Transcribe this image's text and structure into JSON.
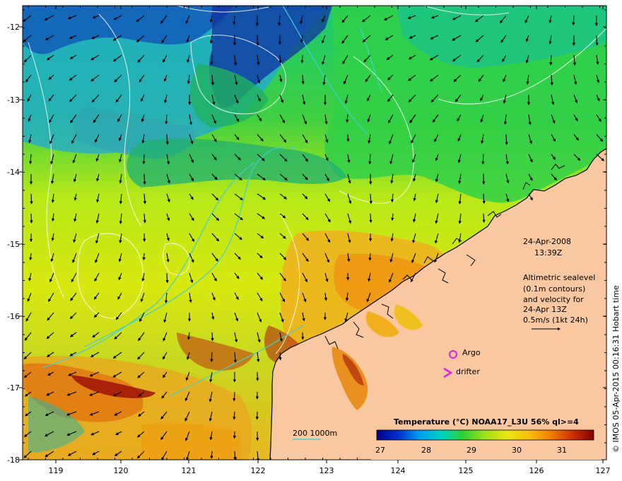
{
  "map": {
    "lon_ticks": [
      "119",
      "120",
      "121",
      "122",
      "123",
      "124",
      "125",
      "126",
      "127"
    ],
    "lat_ticks": [
      "-12",
      "-13",
      "-14",
      "-15",
      "-16",
      "-17",
      "-18"
    ],
    "datetime_line1": "24-Apr-2008",
    "datetime_line2": "13:39Z",
    "altimetry_lines": [
      "Altimetric sealevel",
      "(0.1m contours)",
      "and velocity for",
      "24-Apr 13Z",
      "0.5m/s (1kt 24h)"
    ],
    "argo_label": "Argo",
    "drifter_label": "drifter",
    "drifter_symbol": ">",
    "depth_legend": "200  1000m",
    "credit": "© IMOS 05-Apr-2015 00:16:31 Hobart time",
    "colorbar": {
      "title": "Temperature (°C) NOAA17_L3U 56% ql>=4",
      "labels": [
        "27",
        "28",
        "29",
        "30",
        "31"
      ]
    },
    "colors": {
      "land": "#f9c8a0",
      "argo": "#e020e0",
      "depth_contour": "#40d0d0"
    }
  }
}
